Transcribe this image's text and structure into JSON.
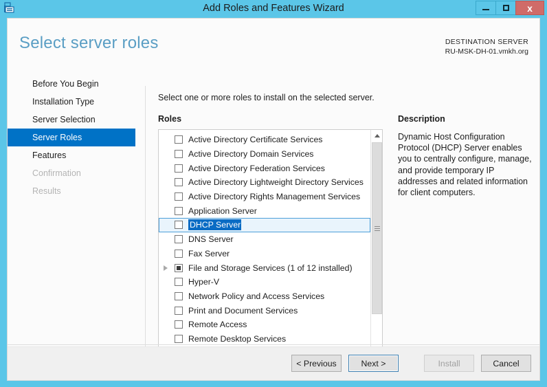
{
  "window": {
    "title": "Add Roles and Features Wizard",
    "icon": "wizard-server-icon",
    "minimize_label": "",
    "maximize_label": "",
    "close_label": "x"
  },
  "header": {
    "page_title": "Select server roles",
    "destination_label": "DESTINATION SERVER",
    "destination_server": "RU-MSK-DH-01.vmkh.org"
  },
  "nav": {
    "items": [
      {
        "label": "Before You Begin",
        "state": "normal"
      },
      {
        "label": "Installation Type",
        "state": "normal"
      },
      {
        "label": "Server Selection",
        "state": "normal"
      },
      {
        "label": "Server Roles",
        "state": "selected"
      },
      {
        "label": "Features",
        "state": "normal"
      },
      {
        "label": "Confirmation",
        "state": "disabled"
      },
      {
        "label": "Results",
        "state": "disabled"
      }
    ]
  },
  "main": {
    "instruction": "Select one or more roles to install on the selected server.",
    "roles_label": "Roles",
    "description_label": "Description",
    "description_body": "Dynamic Host Configuration Protocol (DHCP) Server enables you to centrally configure, manage, and provide temporary IP addresses and related information for client computers.",
    "roles": [
      {
        "label": "Active Directory Certificate Services",
        "checked": false,
        "partial": false,
        "expandable": false,
        "selected": false
      },
      {
        "label": "Active Directory Domain Services",
        "checked": false,
        "partial": false,
        "expandable": false,
        "selected": false
      },
      {
        "label": "Active Directory Federation Services",
        "checked": false,
        "partial": false,
        "expandable": false,
        "selected": false
      },
      {
        "label": "Active Directory Lightweight Directory Services",
        "checked": false,
        "partial": false,
        "expandable": false,
        "selected": false
      },
      {
        "label": "Active Directory Rights Management Services",
        "checked": false,
        "partial": false,
        "expandable": false,
        "selected": false
      },
      {
        "label": "Application Server",
        "checked": false,
        "partial": false,
        "expandable": false,
        "selected": false
      },
      {
        "label": "DHCP Server",
        "checked": false,
        "partial": false,
        "expandable": false,
        "selected": true
      },
      {
        "label": "DNS Server",
        "checked": false,
        "partial": false,
        "expandable": false,
        "selected": false
      },
      {
        "label": "Fax Server",
        "checked": false,
        "partial": false,
        "expandable": false,
        "selected": false
      },
      {
        "label": "File and Storage Services (1 of 12 installed)",
        "checked": false,
        "partial": true,
        "expandable": true,
        "selected": false
      },
      {
        "label": "Hyper-V",
        "checked": false,
        "partial": false,
        "expandable": false,
        "selected": false
      },
      {
        "label": "Network Policy and Access Services",
        "checked": false,
        "partial": false,
        "expandable": false,
        "selected": false
      },
      {
        "label": "Print and Document Services",
        "checked": false,
        "partial": false,
        "expandable": false,
        "selected": false
      },
      {
        "label": "Remote Access",
        "checked": false,
        "partial": false,
        "expandable": false,
        "selected": false
      },
      {
        "label": "Remote Desktop Services",
        "checked": false,
        "partial": false,
        "expandable": false,
        "selected": false
      }
    ]
  },
  "footer": {
    "previous_label": "< Previous",
    "next_label": "Next >",
    "install_label": "Install",
    "cancel_label": "Cancel"
  },
  "colors": {
    "frame": "#5bc6e8",
    "accent_title": "#5a9ec4",
    "nav_selected": "#0072c6",
    "selection_blue": "#0a6cc4",
    "close_red": "#d06b68"
  }
}
